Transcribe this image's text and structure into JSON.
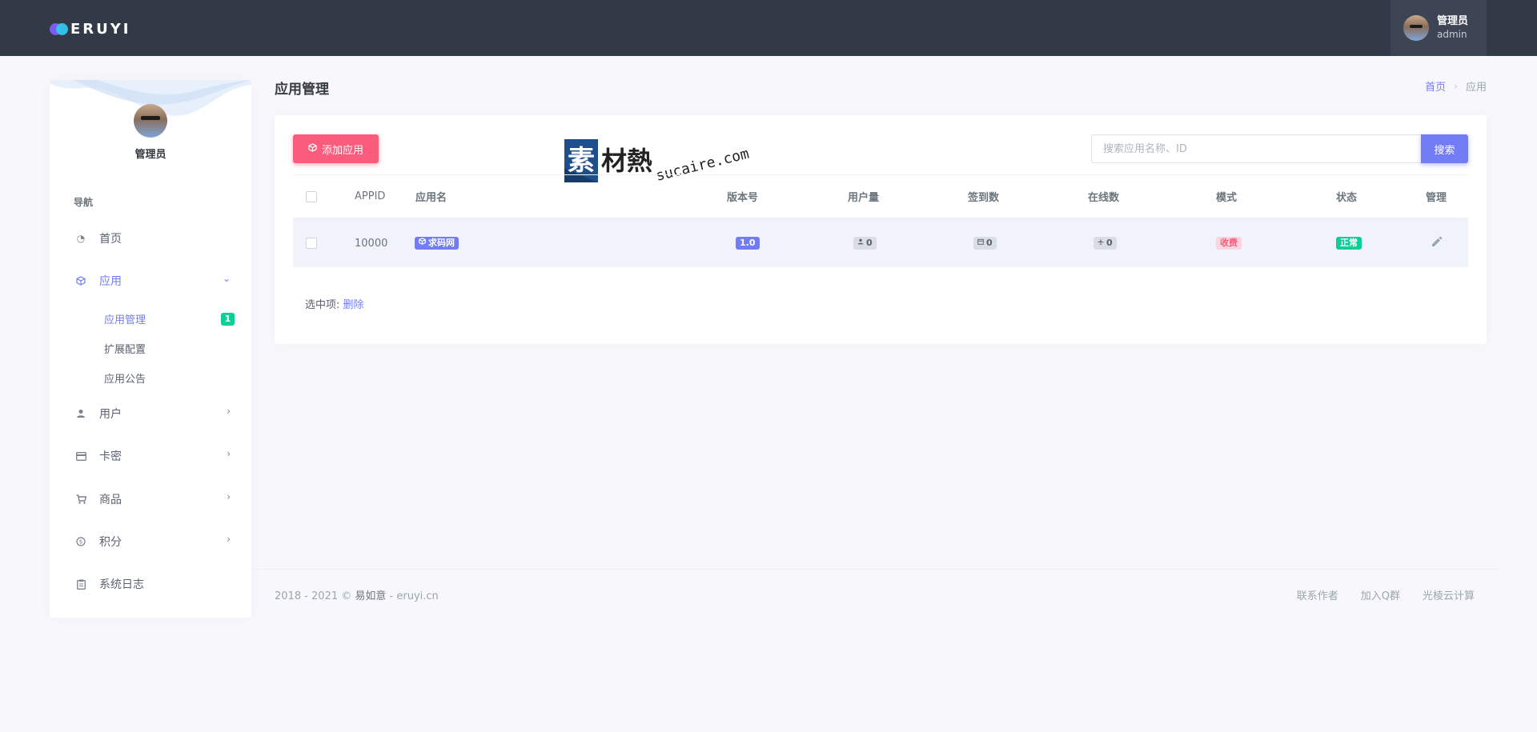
{
  "brand": {
    "name": "ERUYI"
  },
  "topbar": {
    "user_name": "管理员",
    "user_role": "admin"
  },
  "sidebar": {
    "profile_name": "管理员",
    "nav_title": "导航",
    "items": [
      {
        "label": "首页",
        "icon": "dashboard-icon"
      },
      {
        "label": "应用",
        "icon": "cube-icon",
        "expanded": true,
        "children": [
          {
            "label": "应用管理",
            "badge": "1",
            "active": true
          },
          {
            "label": "扩展配置"
          },
          {
            "label": "应用公告"
          }
        ]
      },
      {
        "label": "用户",
        "icon": "user-icon"
      },
      {
        "label": "卡密",
        "icon": "card-icon"
      },
      {
        "label": "商品",
        "icon": "cart-icon"
      },
      {
        "label": "积分",
        "icon": "coin-icon"
      },
      {
        "label": "系统日志",
        "icon": "clipboard-icon"
      }
    ]
  },
  "page": {
    "title": "应用管理",
    "breadcrumb": {
      "home": "首页",
      "separator": "›",
      "current": "应用"
    }
  },
  "toolbar": {
    "add_label": "添加应用",
    "search_placeholder": "搜索应用名称、ID",
    "search_label": "搜索"
  },
  "watermark": {
    "brand": "素材熱",
    "domain": "sucaire.com"
  },
  "table": {
    "headers": {
      "appid": "APPID",
      "name": "应用名",
      "version": "版本号",
      "users": "用户量",
      "signins": "签到数",
      "online": "在线数",
      "mode": "模式",
      "status": "状态",
      "manage": "管理"
    },
    "rows": [
      {
        "appid": "10000",
        "name": "求码网",
        "version": "1.0",
        "users": "0",
        "signins": "0",
        "online": "0",
        "mode": "收费",
        "status": "正常"
      }
    ]
  },
  "bulk": {
    "label": "选中项:",
    "delete_label": "删除"
  },
  "footer": {
    "copyright_prefix": "2018 - 2021 © ",
    "copyright_name": "易如意",
    "copyright_suffix": " - eruyi.cn",
    "links": [
      "联系作者",
      "加入Q群",
      "光棱云计算"
    ]
  },
  "colors": {
    "topbar": "#333a47",
    "primary": "#727cf5",
    "danger": "#fa5c7c",
    "success": "#0acf97",
    "background": "#f8f8fc"
  }
}
